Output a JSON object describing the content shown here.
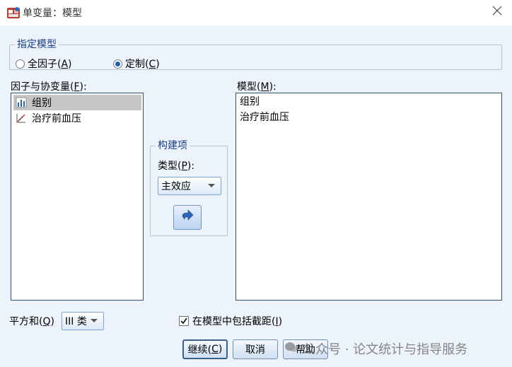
{
  "window": {
    "title": "单变量：模型",
    "close_glyph": "✕"
  },
  "model_spec": {
    "legend": "指定模型",
    "options": [
      {
        "label": "全因子(A)",
        "text": "全因子(",
        "key": "A",
        "tail": ")",
        "checked": false
      },
      {
        "label": "定制(C)",
        "text": "定制(",
        "key": "C",
        "tail": ")",
        "checked": true
      }
    ]
  },
  "factors": {
    "label_text": "因子与协变量(",
    "label_key": "F",
    "label_tail": "):",
    "items": [
      {
        "label": "组别",
        "icon": "nominal-icon",
        "selected": true
      },
      {
        "label": "治疗前血压",
        "icon": "scale-icon",
        "selected": false
      }
    ]
  },
  "build": {
    "legend": "构建项",
    "type_label_text": "类型(",
    "type_label_key": "P",
    "type_label_tail": "):",
    "type_value": "主效应",
    "move_button_icon": "right-arrow-icon"
  },
  "model": {
    "label_text": "模型(",
    "label_key": "M",
    "label_tail": "):",
    "items": [
      "组别",
      "治疗前血压"
    ]
  },
  "sum_of_squares": {
    "label_text": "平方和(",
    "label_key": "Q",
    "label_tail": ")",
    "value": "III 类"
  },
  "intercept": {
    "label_text": "在模型中包括截距(",
    "label_key": "I",
    "label_tail": ")",
    "checked": true
  },
  "buttons": {
    "continue": {
      "text": "继续(",
      "key": "C",
      "tail": ")"
    },
    "cancel": "取消",
    "help": "帮助"
  },
  "watermark": "公众号 · 论文统计与指导服务",
  "colors": {
    "client_bg": "#ecf3fb",
    "legend_text": "#1a3f8c",
    "arrow_blue": "#2c66b8"
  }
}
